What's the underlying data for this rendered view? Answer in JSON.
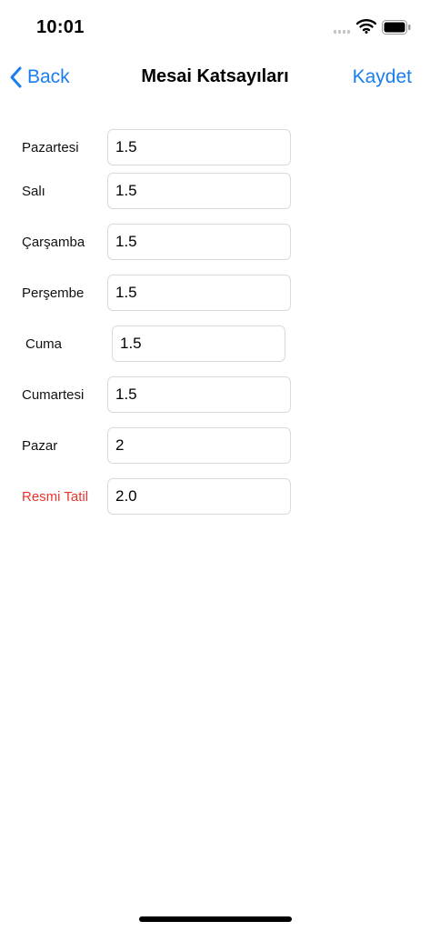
{
  "status_bar": {
    "time": "10:01"
  },
  "nav": {
    "back_label": "Back",
    "title": "Mesai Katsayıları",
    "save_label": "Kaydet"
  },
  "rows": [
    {
      "label": "Pazartesi",
      "value": "1.5"
    },
    {
      "label": "Salı",
      "value": "1.5"
    },
    {
      "label": "Çarşamba",
      "value": "1.5"
    },
    {
      "label": "Perşembe",
      "value": "1.5"
    },
    {
      "label": "Cuma",
      "value": "1.5"
    },
    {
      "label": "Cumartesi",
      "value": "1.5"
    },
    {
      "label": "Pazar",
      "value": "2"
    },
    {
      "label": "Resmi Tatil",
      "value": "2.0"
    }
  ],
  "colors": {
    "accent": "#1a7ef0",
    "holiday": "#e7362f",
    "field_border": "#dadada"
  },
  "icons": [
    "chevron-left-icon",
    "cellular-signal-icon",
    "wifi-icon",
    "battery-icon"
  ]
}
